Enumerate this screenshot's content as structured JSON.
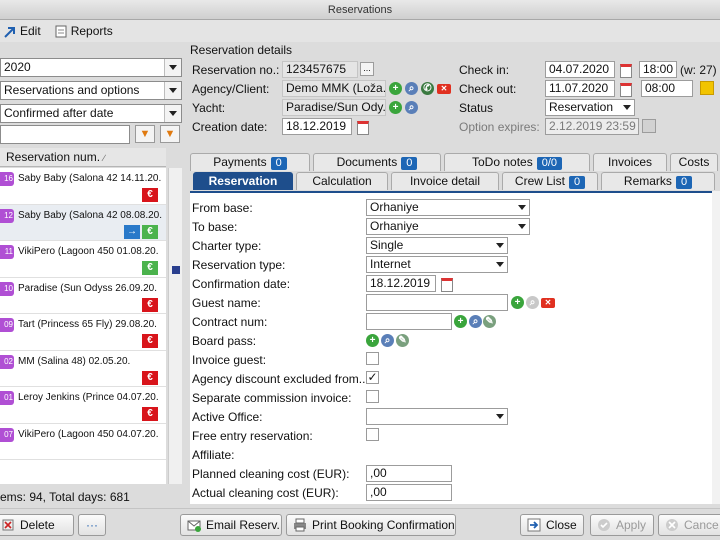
{
  "window": {
    "title": "Reservations"
  },
  "menu": {
    "edit": "Edit",
    "reports": "Reports"
  },
  "filters": {
    "year": "2020",
    "type": "Reservations and options",
    "sort": "Confirmed after date",
    "search_value": ""
  },
  "list": {
    "header": "Reservation num.",
    "rows": [
      {
        "badge": "16",
        "text": "Saby Baby (Salona 42 14.11.20.",
        "icons": [
          "€"
        ]
      },
      {
        "badge": "12",
        "text": "Saby Baby (Salona 42 08.08.20.",
        "icons": [
          "→",
          "€"
        ]
      },
      {
        "badge": "11",
        "text": "VikiPero (Lagoon 450 01.08.20.",
        "icons": [
          "€"
        ]
      },
      {
        "badge": "10",
        "text": "Paradise (Sun Odyss   26.09.20.",
        "icons": [
          "€"
        ]
      },
      {
        "badge": "09",
        "text": "Tart (Princess 65 Fly) 29.08.20.",
        "icons": [
          "€"
        ]
      },
      {
        "badge": "02",
        "text": "MM  (Salina 48)          02.05.20.",
        "icons": [
          "€"
        ]
      },
      {
        "badge": "01",
        "text": "Leroy Jenkins (Prince 04.07.20.",
        "icons": [
          "€"
        ]
      },
      {
        "badge": "07",
        "text": "VikiPero (Lagoon 450 04.07.20.",
        "icons": []
      }
    ],
    "summary": "ems: 94,  Total days: 681"
  },
  "details": {
    "section_title": "Reservation details",
    "reservation_no_label": "Reservation no.:",
    "reservation_no": "123457675",
    "agency_label": "Agency/Client:",
    "agency": "Demo MMK (Loža...",
    "yacht_label": "Yacht:",
    "yacht": "Paradise/Sun Ody...",
    "creation_label": "Creation date:",
    "creation_date": "18.12.2019",
    "checkin_label": "Check in:",
    "checkin_date": "04.07.2020",
    "checkin_time": "18:00",
    "week": "(w: 27)",
    "checkout_label": "Check out:",
    "checkout_date": "11.07.2020",
    "checkout_time": "08:00",
    "status_label": "Status",
    "status": "Reservation",
    "option_label": "Option expires:",
    "option_expires": "2.12.2019 23:59"
  },
  "tabs_top": [
    {
      "label": "Payments",
      "count": "0"
    },
    {
      "label": "Documents",
      "count": "0"
    },
    {
      "label": "ToDo notes",
      "count": "0/0"
    },
    {
      "label": "Invoices",
      "count": ""
    },
    {
      "label": "Costs",
      "count": ""
    }
  ],
  "tabs_bottom": [
    {
      "label": "Reservation",
      "count": ""
    },
    {
      "label": "Calculation",
      "count": ""
    },
    {
      "label": "Invoice detail",
      "count": ""
    },
    {
      "label": "Crew List",
      "count": "0"
    },
    {
      "label": "Remarks",
      "count": "0"
    }
  ],
  "form": {
    "from_base_label": "From base:",
    "from_base": "Orhaniye",
    "to_base_label": "To base:",
    "to_base": "Orhaniye",
    "charter_type_label": "Charter type:",
    "charter_type": "Single",
    "reservation_type_label": "Reservation type:",
    "reservation_type": "Internet",
    "confirmation_label": "Confirmation date:",
    "confirmation_date": "18.12.2019",
    "guest_name_label": "Guest name:",
    "guest_name": "",
    "contract_num_label": "Contract num:",
    "contract_num": "",
    "board_pass_label": "Board pass:",
    "invoice_guest_label": "Invoice guest:",
    "agency_discount_label": "Agency discount excluded from...",
    "separate_commission_label": "Separate commission invoice:",
    "active_office_label": "Active Office:",
    "active_office": "",
    "free_entry_label": "Free entry reservation:",
    "affiliate_label": "Affiliate:",
    "planned_cleaning_label": "Planned cleaning cost (EUR):",
    "planned_cleaning": ",00",
    "actual_cleaning_label": "Actual cleaning cost (EUR):",
    "actual_cleaning": ",00"
  },
  "bottom": {
    "delete": "Delete",
    "more": "···",
    "email": "Email Reserv.",
    "print": "Print Booking Confirmation",
    "close": "Close",
    "apply": "Apply",
    "cancel": "Cance"
  },
  "colors": {
    "accent": "#1e4e8c",
    "badge": "#b04fd4",
    "euro": "#d8141b",
    "check": "#4bb34d"
  }
}
